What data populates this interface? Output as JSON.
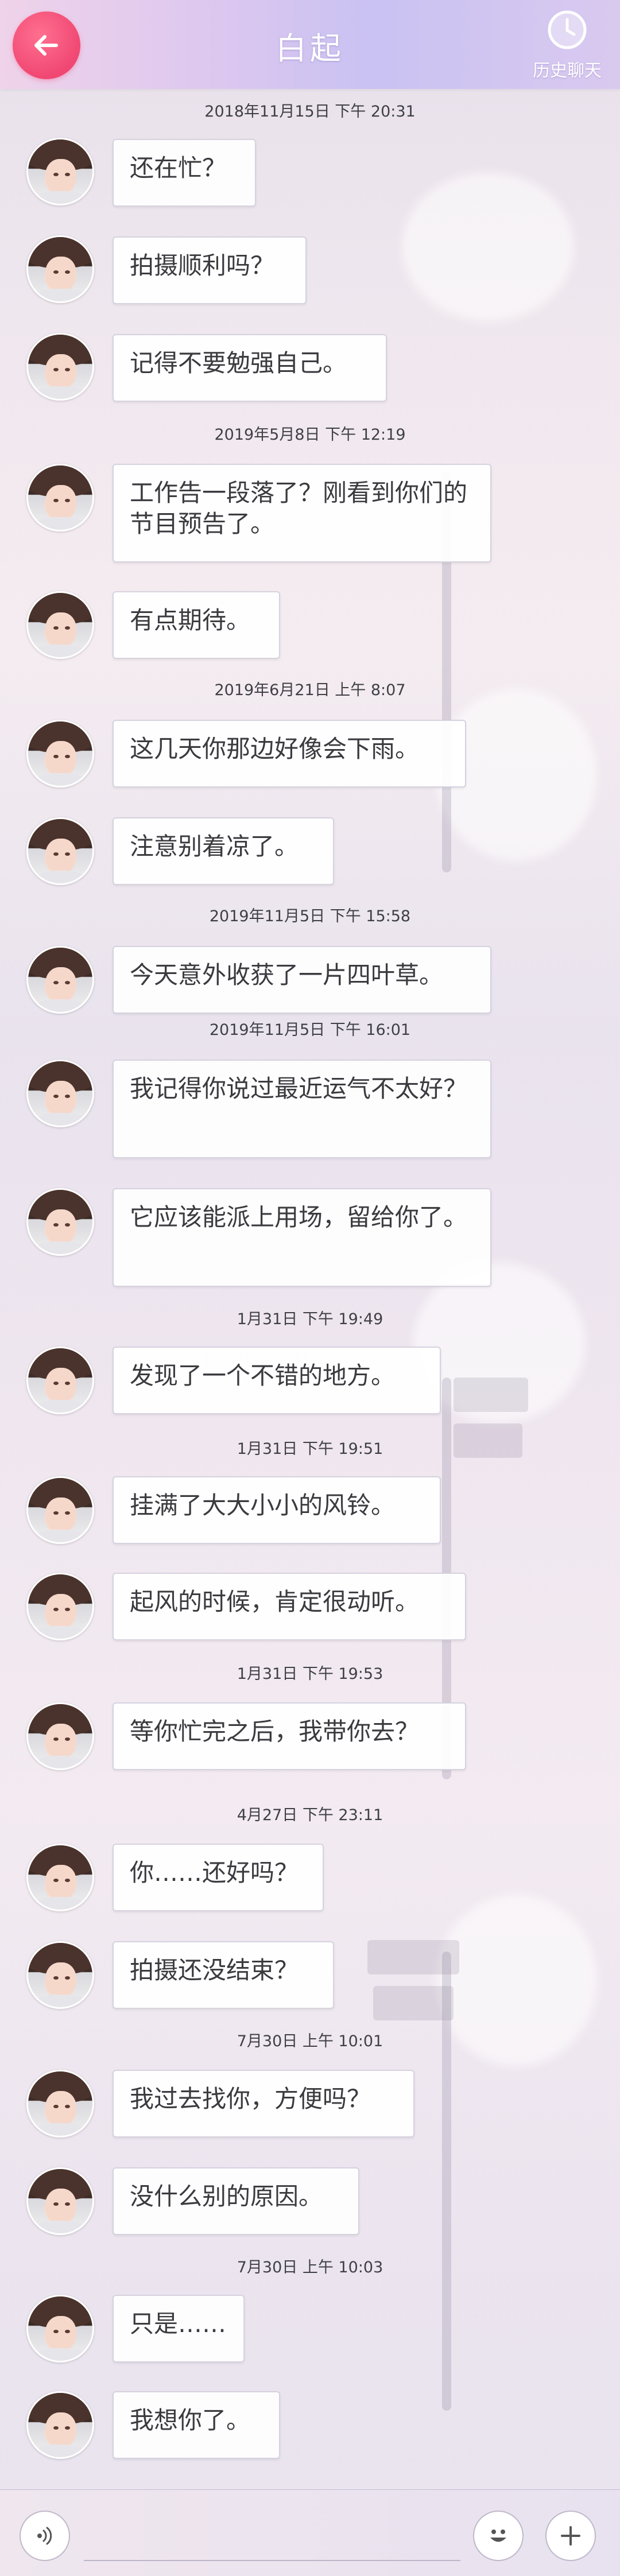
{
  "header": {
    "title": "白起",
    "back_icon": "arrow-left-icon",
    "history_label": "历史聊天",
    "history_icon": "clock-icon",
    "accent": "#f04873"
  },
  "chat": {
    "timestamps": [
      "2018年11月15日  下午 20:31",
      "2019年5月8日  下午 12:19",
      "2019年6月21日  上午 8:07",
      "2019年11月5日  下午 15:58",
      "2019年11月5日  下午 16:01",
      "1月31日  下午 19:49",
      "1月31日  下午 19:51",
      "1月31日  下午 19:53",
      "4月27日  下午 23:11",
      "7月30日  上午 10:01",
      "7月30日  上午 10:03"
    ],
    "messages": [
      "还在忙？",
      "拍摄顺利吗？",
      "记得不要勉强自己。",
      "工作告一段落了？刚看到你们的节目预告了。",
      "有点期待。",
      "这几天你那边好像会下雨。",
      "注意别着凉了。",
      "今天意外收获了一片四叶草。",
      "我记得你说过最近运气不太好？",
      "它应该能派上用场，留给你了。",
      "发现了一个不错的地方。",
      "挂满了大大小小的风铃。",
      "起风的时候，肯定很动听。",
      "等你忙完之后，我带你去？",
      "你……还好吗？",
      "拍摄还没结束？",
      "我过去找你，方便吗？",
      "没什么别的原因。",
      "只是……",
      "我想你了。"
    ]
  },
  "bottom_bar": {
    "voice_icon": "voice-icon",
    "emoji_icon": "emoji-icon",
    "plus_icon": "plus-icon"
  }
}
